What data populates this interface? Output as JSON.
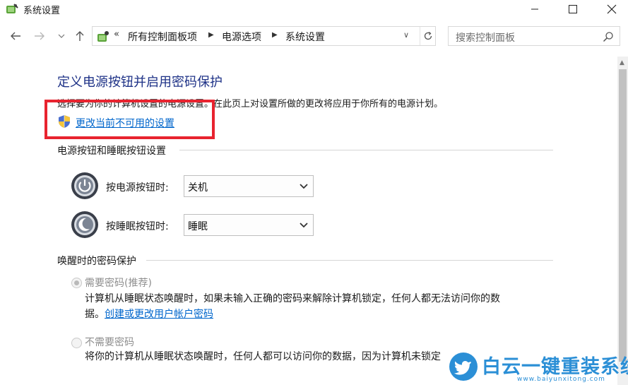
{
  "window": {
    "title": "系统设置",
    "icon": "power-options-icon",
    "controls": [
      "minimize-icon",
      "maximize-icon",
      "close-icon"
    ]
  },
  "nav": {
    "back_icon": "back-arrow-icon",
    "forward_icon": "forward-arrow-icon",
    "recent_icon": "chevron-down-icon",
    "up_icon": "up-arrow-icon",
    "breadcrumb_prefix": "«",
    "breadcrumbs": [
      "所有控制面板项",
      "电源选项",
      "系统设置"
    ],
    "refresh_icon": "refresh-icon",
    "search_placeholder": "搜索控制面板"
  },
  "content": {
    "heading": "定义电源按钮并启用密码保护",
    "description": "选择要为你的计算机设置的电源设置。在此页上对设置所做的更改将应用于你所有的电源计划。",
    "change_link": "更改当前不可用的设置",
    "highlight_color": "#e8232f",
    "buttons_section": {
      "title": "电源按钮和睡眠按钮设置",
      "rows": [
        {
          "label": "按电源按钮时:",
          "value": "关机",
          "icon": "power-button-icon"
        },
        {
          "label": "按睡眠按钮时:",
          "value": "睡眠",
          "icon": "sleep-button-icon"
        }
      ]
    },
    "password_section": {
      "title": "唤醒时的密码保护",
      "options": [
        {
          "label": "需要密码(推荐)",
          "selected": true,
          "text_line1": "计算机从睡眠状态唤醒时，如果未输入正确的密码来解除计算机锁定，任何人都无法访问你的数",
          "text_line2_prefix": "据。",
          "text_link": "创建或更改用户帐户密码"
        },
        {
          "label": "不需要密码",
          "selected": false,
          "text_line1": "将你的计算机从睡眠状态唤醒时，任何人都可以访问你的数据，因为计算机未锁定"
        }
      ]
    }
  },
  "watermark": {
    "text": "白云一键重装系统",
    "url": "www.baiyunxitong.com",
    "color": "#2b8fd6"
  }
}
